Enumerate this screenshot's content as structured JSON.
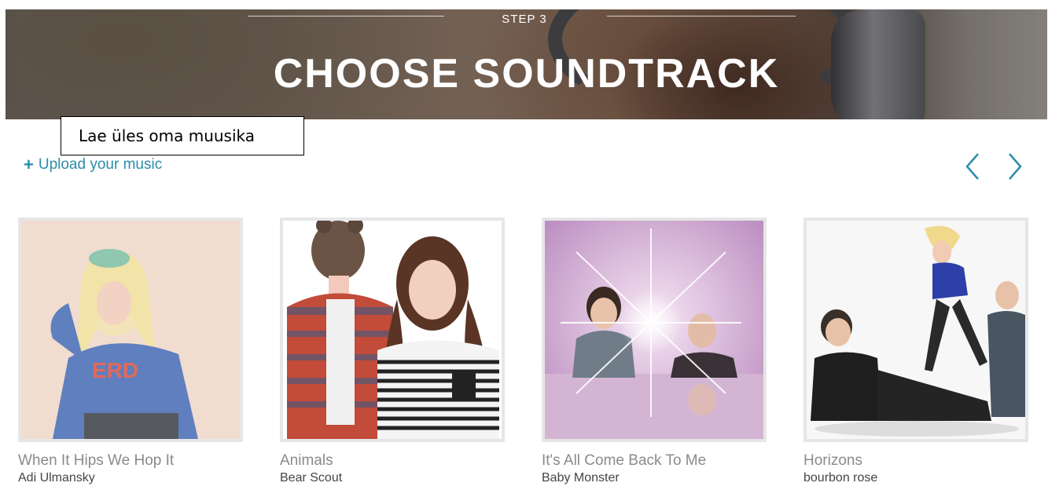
{
  "hero": {
    "step_label": "STEP 3",
    "title": "CHOOSE SOUNDTRACK"
  },
  "callout": {
    "text": "Lae üles oma muusika"
  },
  "upload": {
    "plus": "+",
    "label": "Upload your music"
  },
  "nav": {
    "prev_icon": "chevron-left-icon",
    "next_icon": "chevron-right-icon",
    "color": "#2b8da8"
  },
  "tracks": [
    {
      "title": "When It Hips We Hop It",
      "artist": "Adi Ulmansky"
    },
    {
      "title": "Animals",
      "artist": "Bear Scout"
    },
    {
      "title": "It's All Come Back To Me",
      "artist": "Baby Monster"
    },
    {
      "title": "Horizons",
      "artist": "bourbon rose"
    }
  ]
}
